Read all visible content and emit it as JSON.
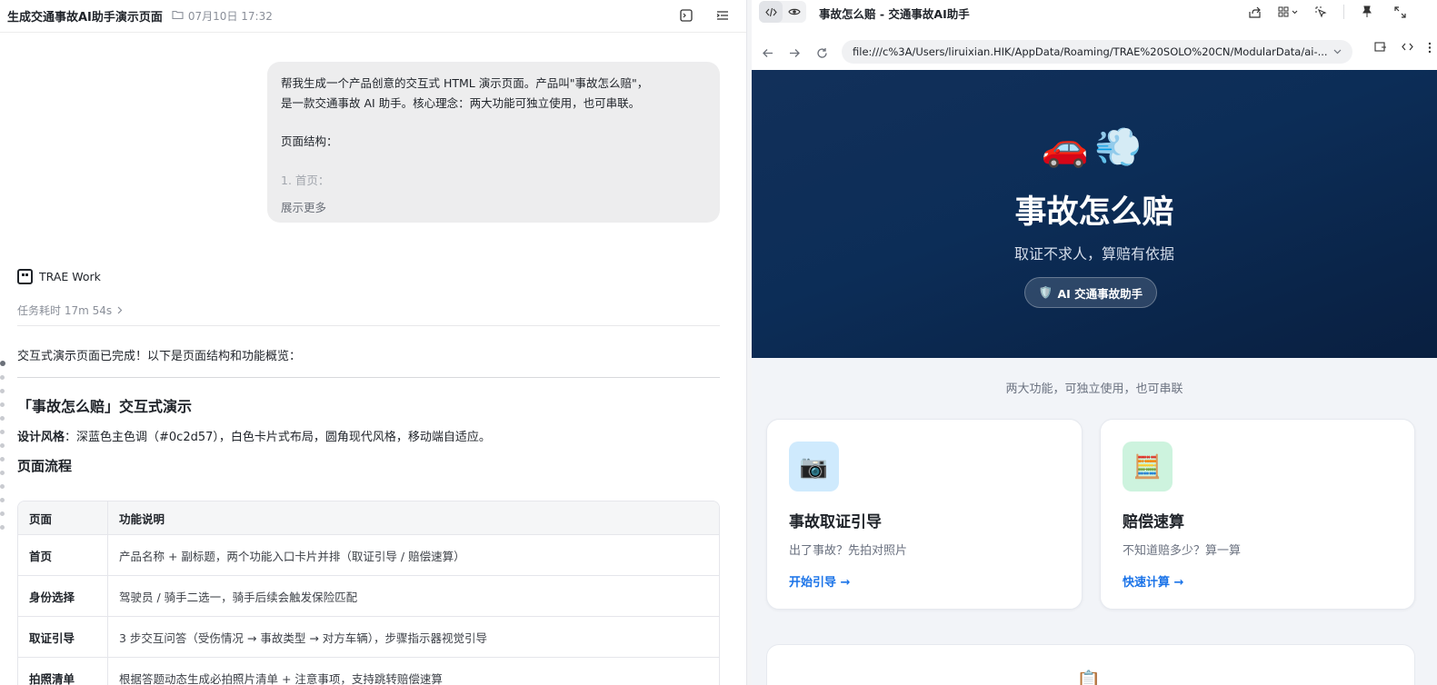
{
  "left": {
    "title": "生成交通事故AI助手演示页面",
    "date": "07月10日 17:32",
    "message_lines": [
      "帮我生成一个产品创意的交互式 HTML 演示页面。产品叫\"事故怎么赔\"，",
      "是一款交通事故 AI 助手。核心理念：两大功能可独立使用，也可串联。",
      "",
      "页面结构：",
      "",
      "1. 首页："
    ],
    "show_more": "展示更多",
    "agent_name": "TRAE Work",
    "task_time": "任务耗时 17m 54s",
    "intro": "交互式演示页面已完成！以下是页面结构和功能概览：",
    "demo_heading": "「事故怎么赔」交互式演示",
    "style_label": "设计风格",
    "style_text": "：深蓝色主色调（#0c2d57），白色卡片式布局，圆角现代风格，移动端自适应。",
    "flow_heading": "页面流程",
    "table": {
      "headers": [
        "页面",
        "功能说明"
      ],
      "rows": [
        [
          "首页",
          "产品名称 + 副标题，两个功能入口卡片并排（取证引导 / 赔偿速算）"
        ],
        [
          "身份选择",
          "驾驶员 / 骑手二选一，骑手后续会触发保险匹配"
        ],
        [
          "取证引导",
          "3 步交互问答（受伤情况 → 事故类型 → 对方车辆），步骤指示器视觉引导"
        ],
        [
          "拍照清单",
          "根据答题动态生成必拍照片清单 + 注意事项，支持跳转赔偿速算"
        ]
      ]
    }
  },
  "right": {
    "window_title": "事故怎么赔 - 交通事故AI助手",
    "url": "file:///c%3A/Users/liruixian.HIK/AppData/Roaming/TRAE%20SOLO%20CN/ModularData/ai-...",
    "hero": {
      "emoji": "🚗💨",
      "title": "事故怎么赔",
      "subtitle": "取证不求人，算赔有依据",
      "pill_icon": "🛡️",
      "pill_label": "AI 交通事故助手",
      "bg_color": "#0c2d57"
    },
    "tagline": "两大功能，可独立使用，也可串联",
    "cards": [
      {
        "icon": "📷",
        "title": "事故取证引导",
        "desc": "出了事故？先拍对照片",
        "link": "开始引导 →"
      },
      {
        "icon": "🧮",
        "title": "赔偿速算",
        "desc": "不知道赔多少？算一算",
        "link": "快速计算 →"
      }
    ],
    "card3_icon": "📋",
    "accent_link": "#1a73e8"
  }
}
